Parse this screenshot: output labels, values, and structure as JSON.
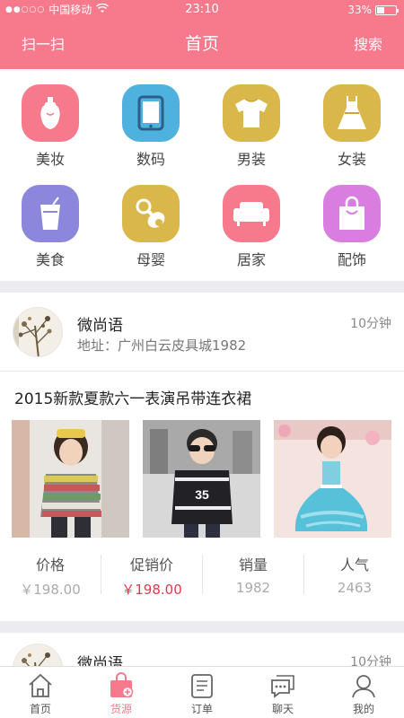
{
  "status": {
    "carrier": "中国移动",
    "time": "23:10",
    "battery": "33%",
    "battery_level": 0.33
  },
  "nav": {
    "left": "扫一扫",
    "title": "首页",
    "right": "搜索"
  },
  "categories": [
    {
      "label": "美妆",
      "icon": "perfume-icon",
      "color": "#f7798c"
    },
    {
      "label": "数码",
      "icon": "tablet-icon",
      "color": "#4fb1de"
    },
    {
      "label": "男装",
      "icon": "tshirt-icon",
      "color": "#d9b74a"
    },
    {
      "label": "女装",
      "icon": "dress-icon",
      "color": "#d9b74a"
    },
    {
      "label": "美食",
      "icon": "drink-icon",
      "color": "#8b87dc"
    },
    {
      "label": "母婴",
      "icon": "pacifier-icon",
      "color": "#d9b74a"
    },
    {
      "label": "居家",
      "icon": "sofa-icon",
      "color": "#f7798c"
    },
    {
      "label": "配饰",
      "icon": "bag-icon",
      "color": "#d97ee0"
    }
  ],
  "shops": [
    {
      "name": "微尚语",
      "time": "10分钟",
      "address": "地址：广州白云皮具城1982",
      "product_title": "2015新款夏款六一表演吊带连衣裙",
      "stats": [
        {
          "label": "价格",
          "value": "￥198.00"
        },
        {
          "label": "促销价",
          "value": "￥198.00"
        },
        {
          "label": "销量",
          "value": "1982"
        },
        {
          "label": "人气",
          "value": "2463"
        }
      ]
    },
    {
      "name": "微尚语",
      "time": "10分钟"
    }
  ],
  "tabs": [
    {
      "label": "首页",
      "icon": "home-icon"
    },
    {
      "label": "货源",
      "icon": "shopping-bag-icon",
      "active": true
    },
    {
      "label": "订单",
      "icon": "order-list-icon"
    },
    {
      "label": "聊天",
      "icon": "chat-icon"
    },
    {
      "label": "我的",
      "icon": "user-icon"
    }
  ],
  "colors": {
    "brand": "#f7798c",
    "price_red": "#e3374a",
    "separator": "#ececf0"
  }
}
